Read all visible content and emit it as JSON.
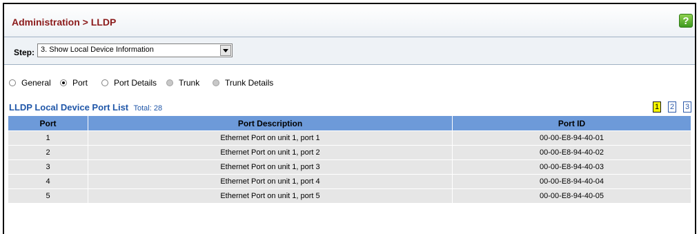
{
  "header": {
    "title": "Administration > LLDP",
    "help_label": "?"
  },
  "step": {
    "label": "Step:",
    "value": "3. Show Local Device Information"
  },
  "radios": [
    {
      "label": "General",
      "state": "unchecked"
    },
    {
      "label": "Port",
      "state": "checked"
    },
    {
      "label": "Port Details",
      "state": "unchecked"
    },
    {
      "label": "Trunk",
      "state": "disabled"
    },
    {
      "label": "Trunk Details",
      "state": "disabled"
    }
  ],
  "list": {
    "title": "LLDP Local Device Port List",
    "total": "Total: 28"
  },
  "pager": {
    "pages": [
      "1",
      "2",
      "3"
    ],
    "active": "1"
  },
  "table": {
    "headers": [
      "Port",
      "Port Description",
      "Port ID"
    ],
    "rows": [
      [
        "1",
        "Ethernet Port on unit 1, port 1",
        "00-00-E8-94-40-01"
      ],
      [
        "2",
        "Ethernet Port on unit 1, port 2",
        "00-00-E8-94-40-02"
      ],
      [
        "3",
        "Ethernet Port on unit 1, port 3",
        "00-00-E8-94-40-03"
      ],
      [
        "4",
        "Ethernet Port on unit 1, port 4",
        "00-00-E8-94-40-04"
      ],
      [
        "5",
        "Ethernet Port on unit 1, port 5",
        "00-00-E8-94-40-05"
      ]
    ]
  },
  "colors": {
    "title": "#8b1a1a",
    "link": "#1f56a8",
    "table_header": "#6d9ad9",
    "row_bg": "#e6e6e6",
    "active_page": "#f5f500"
  }
}
